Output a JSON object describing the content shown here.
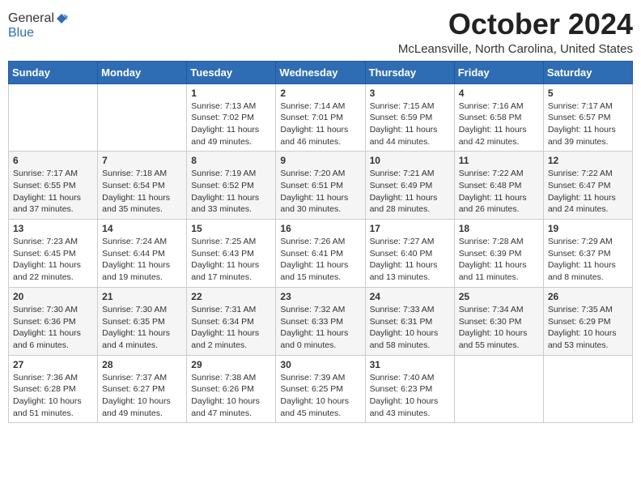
{
  "header": {
    "logo_general": "General",
    "logo_blue": "Blue",
    "month": "October 2024",
    "location": "McLeansville, North Carolina, United States"
  },
  "weekdays": [
    "Sunday",
    "Monday",
    "Tuesday",
    "Wednesday",
    "Thursday",
    "Friday",
    "Saturday"
  ],
  "weeks": [
    [
      {
        "day": "",
        "sunrise": "",
        "sunset": "",
        "daylight": ""
      },
      {
        "day": "",
        "sunrise": "",
        "sunset": "",
        "daylight": ""
      },
      {
        "day": "1",
        "sunrise": "Sunrise: 7:13 AM",
        "sunset": "Sunset: 7:02 PM",
        "daylight": "Daylight: 11 hours and 49 minutes."
      },
      {
        "day": "2",
        "sunrise": "Sunrise: 7:14 AM",
        "sunset": "Sunset: 7:01 PM",
        "daylight": "Daylight: 11 hours and 46 minutes."
      },
      {
        "day": "3",
        "sunrise": "Sunrise: 7:15 AM",
        "sunset": "Sunset: 6:59 PM",
        "daylight": "Daylight: 11 hours and 44 minutes."
      },
      {
        "day": "4",
        "sunrise": "Sunrise: 7:16 AM",
        "sunset": "Sunset: 6:58 PM",
        "daylight": "Daylight: 11 hours and 42 minutes."
      },
      {
        "day": "5",
        "sunrise": "Sunrise: 7:17 AM",
        "sunset": "Sunset: 6:57 PM",
        "daylight": "Daylight: 11 hours and 39 minutes."
      }
    ],
    [
      {
        "day": "6",
        "sunrise": "Sunrise: 7:17 AM",
        "sunset": "Sunset: 6:55 PM",
        "daylight": "Daylight: 11 hours and 37 minutes."
      },
      {
        "day": "7",
        "sunrise": "Sunrise: 7:18 AM",
        "sunset": "Sunset: 6:54 PM",
        "daylight": "Daylight: 11 hours and 35 minutes."
      },
      {
        "day": "8",
        "sunrise": "Sunrise: 7:19 AM",
        "sunset": "Sunset: 6:52 PM",
        "daylight": "Daylight: 11 hours and 33 minutes."
      },
      {
        "day": "9",
        "sunrise": "Sunrise: 7:20 AM",
        "sunset": "Sunset: 6:51 PM",
        "daylight": "Daylight: 11 hours and 30 minutes."
      },
      {
        "day": "10",
        "sunrise": "Sunrise: 7:21 AM",
        "sunset": "Sunset: 6:49 PM",
        "daylight": "Daylight: 11 hours and 28 minutes."
      },
      {
        "day": "11",
        "sunrise": "Sunrise: 7:22 AM",
        "sunset": "Sunset: 6:48 PM",
        "daylight": "Daylight: 11 hours and 26 minutes."
      },
      {
        "day": "12",
        "sunrise": "Sunrise: 7:22 AM",
        "sunset": "Sunset: 6:47 PM",
        "daylight": "Daylight: 11 hours and 24 minutes."
      }
    ],
    [
      {
        "day": "13",
        "sunrise": "Sunrise: 7:23 AM",
        "sunset": "Sunset: 6:45 PM",
        "daylight": "Daylight: 11 hours and 22 minutes."
      },
      {
        "day": "14",
        "sunrise": "Sunrise: 7:24 AM",
        "sunset": "Sunset: 6:44 PM",
        "daylight": "Daylight: 11 hours and 19 minutes."
      },
      {
        "day": "15",
        "sunrise": "Sunrise: 7:25 AM",
        "sunset": "Sunset: 6:43 PM",
        "daylight": "Daylight: 11 hours and 17 minutes."
      },
      {
        "day": "16",
        "sunrise": "Sunrise: 7:26 AM",
        "sunset": "Sunset: 6:41 PM",
        "daylight": "Daylight: 11 hours and 15 minutes."
      },
      {
        "day": "17",
        "sunrise": "Sunrise: 7:27 AM",
        "sunset": "Sunset: 6:40 PM",
        "daylight": "Daylight: 11 hours and 13 minutes."
      },
      {
        "day": "18",
        "sunrise": "Sunrise: 7:28 AM",
        "sunset": "Sunset: 6:39 PM",
        "daylight": "Daylight: 11 hours and 11 minutes."
      },
      {
        "day": "19",
        "sunrise": "Sunrise: 7:29 AM",
        "sunset": "Sunset: 6:37 PM",
        "daylight": "Daylight: 11 hours and 8 minutes."
      }
    ],
    [
      {
        "day": "20",
        "sunrise": "Sunrise: 7:30 AM",
        "sunset": "Sunset: 6:36 PM",
        "daylight": "Daylight: 11 hours and 6 minutes."
      },
      {
        "day": "21",
        "sunrise": "Sunrise: 7:30 AM",
        "sunset": "Sunset: 6:35 PM",
        "daylight": "Daylight: 11 hours and 4 minutes."
      },
      {
        "day": "22",
        "sunrise": "Sunrise: 7:31 AM",
        "sunset": "Sunset: 6:34 PM",
        "daylight": "Daylight: 11 hours and 2 minutes."
      },
      {
        "day": "23",
        "sunrise": "Sunrise: 7:32 AM",
        "sunset": "Sunset: 6:33 PM",
        "daylight": "Daylight: 11 hours and 0 minutes."
      },
      {
        "day": "24",
        "sunrise": "Sunrise: 7:33 AM",
        "sunset": "Sunset: 6:31 PM",
        "daylight": "Daylight: 10 hours and 58 minutes."
      },
      {
        "day": "25",
        "sunrise": "Sunrise: 7:34 AM",
        "sunset": "Sunset: 6:30 PM",
        "daylight": "Daylight: 10 hours and 55 minutes."
      },
      {
        "day": "26",
        "sunrise": "Sunrise: 7:35 AM",
        "sunset": "Sunset: 6:29 PM",
        "daylight": "Daylight: 10 hours and 53 minutes."
      }
    ],
    [
      {
        "day": "27",
        "sunrise": "Sunrise: 7:36 AM",
        "sunset": "Sunset: 6:28 PM",
        "daylight": "Daylight: 10 hours and 51 minutes."
      },
      {
        "day": "28",
        "sunrise": "Sunrise: 7:37 AM",
        "sunset": "Sunset: 6:27 PM",
        "daylight": "Daylight: 10 hours and 49 minutes."
      },
      {
        "day": "29",
        "sunrise": "Sunrise: 7:38 AM",
        "sunset": "Sunset: 6:26 PM",
        "daylight": "Daylight: 10 hours and 47 minutes."
      },
      {
        "day": "30",
        "sunrise": "Sunrise: 7:39 AM",
        "sunset": "Sunset: 6:25 PM",
        "daylight": "Daylight: 10 hours and 45 minutes."
      },
      {
        "day": "31",
        "sunrise": "Sunrise: 7:40 AM",
        "sunset": "Sunset: 6:23 PM",
        "daylight": "Daylight: 10 hours and 43 minutes."
      },
      {
        "day": "",
        "sunrise": "",
        "sunset": "",
        "daylight": ""
      },
      {
        "day": "",
        "sunrise": "",
        "sunset": "",
        "daylight": ""
      }
    ]
  ]
}
